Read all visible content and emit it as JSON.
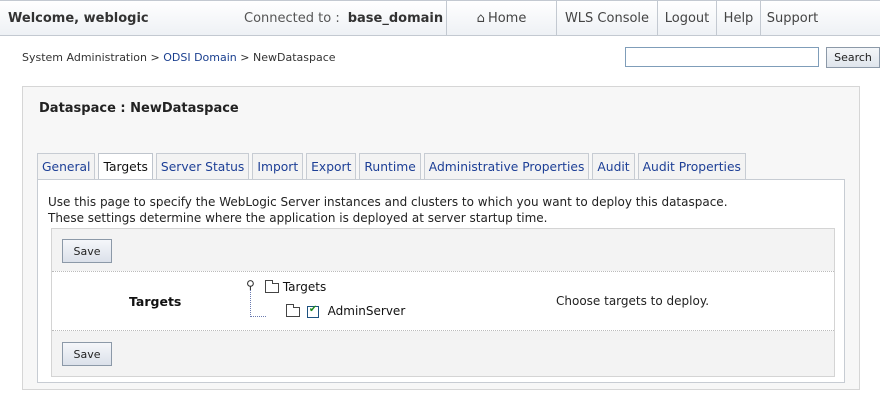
{
  "header": {
    "welcome": "Welcome, weblogic",
    "connected_label": "Connected to :",
    "domain": "base_domain",
    "nav": [
      {
        "label": "Home",
        "icon": "home-icon",
        "width": 110
      },
      {
        "label": "WLS Console",
        "width": 101
      },
      {
        "label": "Logout",
        "width": 59
      },
      {
        "label": "Help",
        "width": 44
      },
      {
        "label": "Support",
        "width": 64
      }
    ]
  },
  "breadcrumb": {
    "root": "System Administration",
    "sep1": " > ",
    "link": "ODSI Domain",
    "sep2": "  > ",
    "current": "NewDataspace"
  },
  "search": {
    "placeholder": "",
    "button": "Search"
  },
  "panel": {
    "title": "Dataspace : NewDataspace",
    "tabs": [
      {
        "label": "General"
      },
      {
        "label": "Targets",
        "active": true
      },
      {
        "label": "Server Status"
      },
      {
        "label": "Import"
      },
      {
        "label": "Export"
      },
      {
        "label": "Runtime"
      },
      {
        "label": "Administrative Properties"
      },
      {
        "label": "Audit"
      },
      {
        "label": "Audit Properties"
      }
    ],
    "description_line1": "Use this page to specify the WebLogic Server instances and clusters to which you want to deploy this dataspace.",
    "description_line2": "These settings determine where the application is deployed at server startup time.",
    "save_label": "Save",
    "targets_label": "Targets",
    "tree": {
      "root": "Targets",
      "child": "AdminServer",
      "child_checked": true
    },
    "hint": "Choose targets to deploy."
  }
}
